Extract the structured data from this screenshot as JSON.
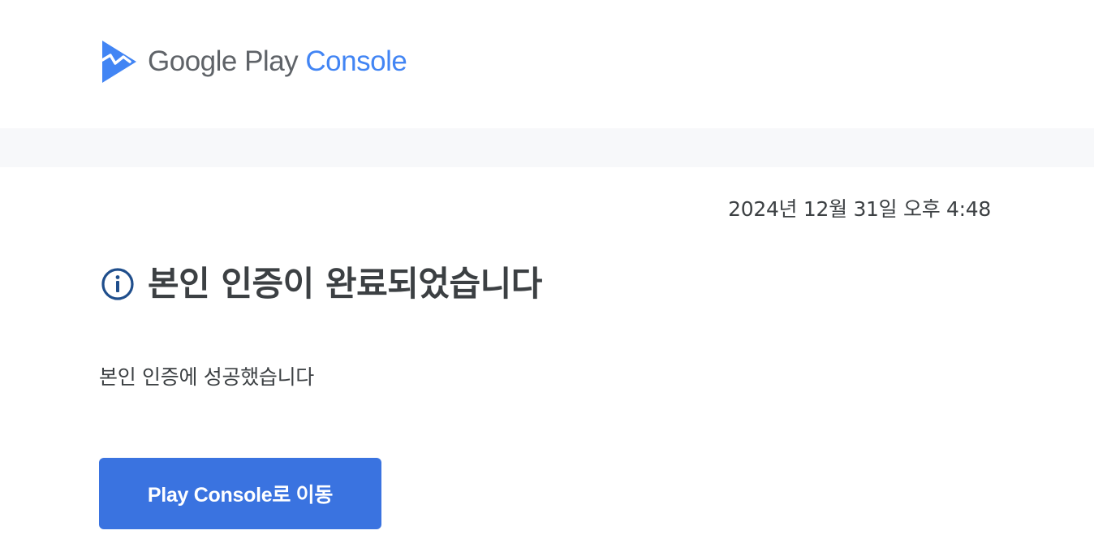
{
  "brand": {
    "google_play": "Google Play",
    "console": "Console",
    "logo_icon": "play-console-icon",
    "colors": {
      "mark": "#4285f4",
      "google_text": "#5f6368",
      "console_text": "#4285f4"
    }
  },
  "email": {
    "timestamp": "2024년 12월 31일 오후 4:48",
    "title_icon": "info-icon",
    "title": "본인 인증이 완료되었습니다",
    "message": "본인 인증에 성공했습니다",
    "cta_label": "Play Console로 이동"
  },
  "colors": {
    "background": "#ffffff",
    "band": "#f7f8fa",
    "text": "#3c4043",
    "info_icon": "#1f4e8c",
    "button": "#3a73e0",
    "button_text": "#ffffff"
  }
}
